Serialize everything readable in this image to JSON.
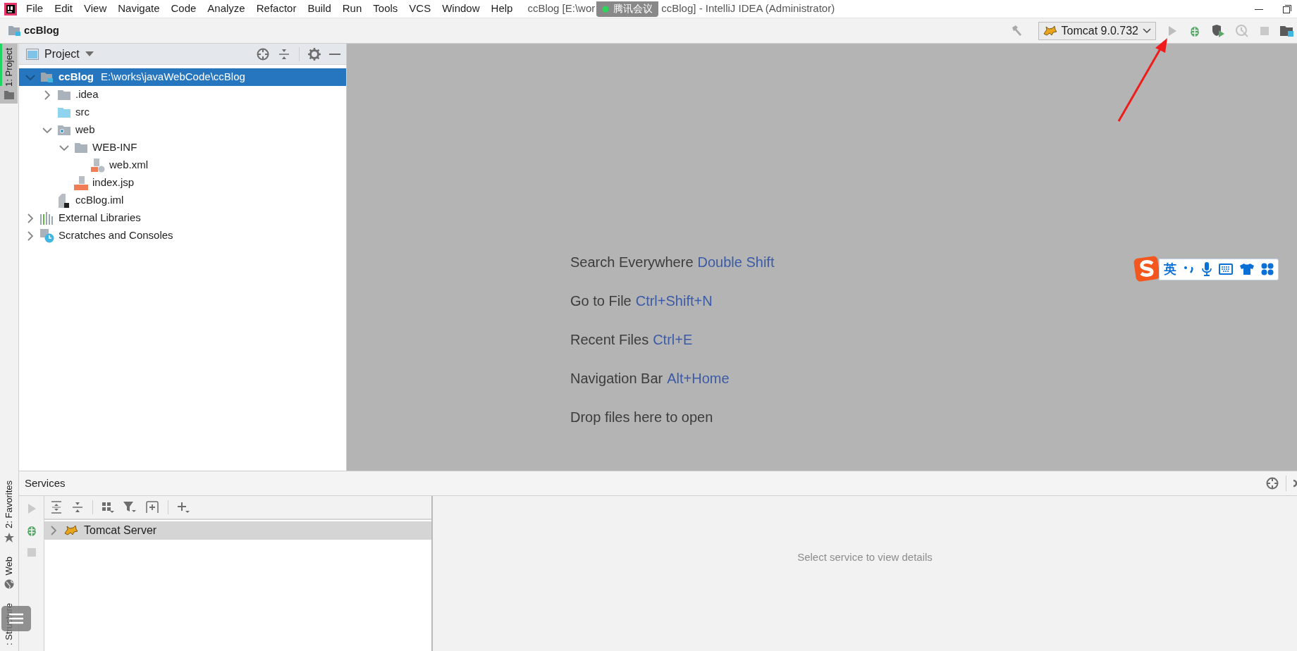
{
  "menu": [
    {
      "label": "File"
    },
    {
      "label": "Edit"
    },
    {
      "label": "View"
    },
    {
      "label": "Navigate"
    },
    {
      "label": "Code"
    },
    {
      "label": "Analyze"
    },
    {
      "label": "Refactor"
    },
    {
      "label": "Build"
    },
    {
      "label": "Run"
    },
    {
      "label": "Tools"
    },
    {
      "label": "VCS"
    },
    {
      "label": "Window"
    },
    {
      "label": "Help"
    }
  ],
  "window_title": {
    "before": "ccBlog [E:\\wor",
    "after": "ccBlog] - IntelliJ IDEA (Administrator)"
  },
  "meeting_overlay": {
    "label": "腾讯会议"
  },
  "breadcrumb": "ccBlog",
  "run_config": "Tomcat 9.0.732",
  "left_tool_tabs": [
    {
      "label": "1: Project",
      "selected": true,
      "kind": "folder"
    }
  ],
  "left_tool_tabs_bottom": [
    {
      "label": "2: Favorites",
      "selected": false,
      "kind": "star"
    },
    {
      "label": "Web",
      "selected": false,
      "kind": "globe"
    },
    {
      "label": ": Structure",
      "selected": false,
      "kind": "structure"
    }
  ],
  "project_panel": {
    "title": "Project",
    "tree": [
      {
        "label": "ccBlog",
        "path": "E:\\works\\javaWebCode\\ccBlog",
        "kind": "module",
        "expanded": true,
        "selected": true,
        "children": [
          {
            "label": ".idea",
            "kind": "folder",
            "expanded": false,
            "selected": false
          },
          {
            "label": "src",
            "kind": "source",
            "selected": false
          },
          {
            "label": "web",
            "kind": "web",
            "expanded": true,
            "selected": false,
            "children": [
              {
                "label": "WEB-INF",
                "kind": "folder",
                "expanded": true,
                "selected": false,
                "children": [
                  {
                    "label": "web.xml",
                    "kind": "xml",
                    "selected": false
                  }
                ]
              },
              {
                "label": "index.jsp",
                "kind": "jsp",
                "selected": false
              }
            ]
          },
          {
            "label": "ccBlog.iml",
            "kind": "iml",
            "selected": false
          }
        ]
      },
      {
        "label": "External Libraries",
        "kind": "libraries",
        "expanded": false,
        "selected": false
      },
      {
        "label": "Scratches and Consoles",
        "kind": "scratches",
        "expanded": false,
        "selected": false
      }
    ]
  },
  "welcome": [
    {
      "action": "Search Everywhere",
      "shortcut": "Double Shift"
    },
    {
      "action": "Go to File",
      "shortcut": "Ctrl+Shift+N"
    },
    {
      "action": "Recent Files",
      "shortcut": "Ctrl+E"
    },
    {
      "action": "Navigation Bar",
      "shortcut": "Alt+Home"
    },
    {
      "action": "Drop files here to open"
    }
  ],
  "ime_toolbar": {
    "mode": "英"
  },
  "services": {
    "title": "Services",
    "tree": [
      {
        "label": "Tomcat Server",
        "expanded": false,
        "selected": true
      }
    ],
    "empty_text": "Select service to view details"
  }
}
